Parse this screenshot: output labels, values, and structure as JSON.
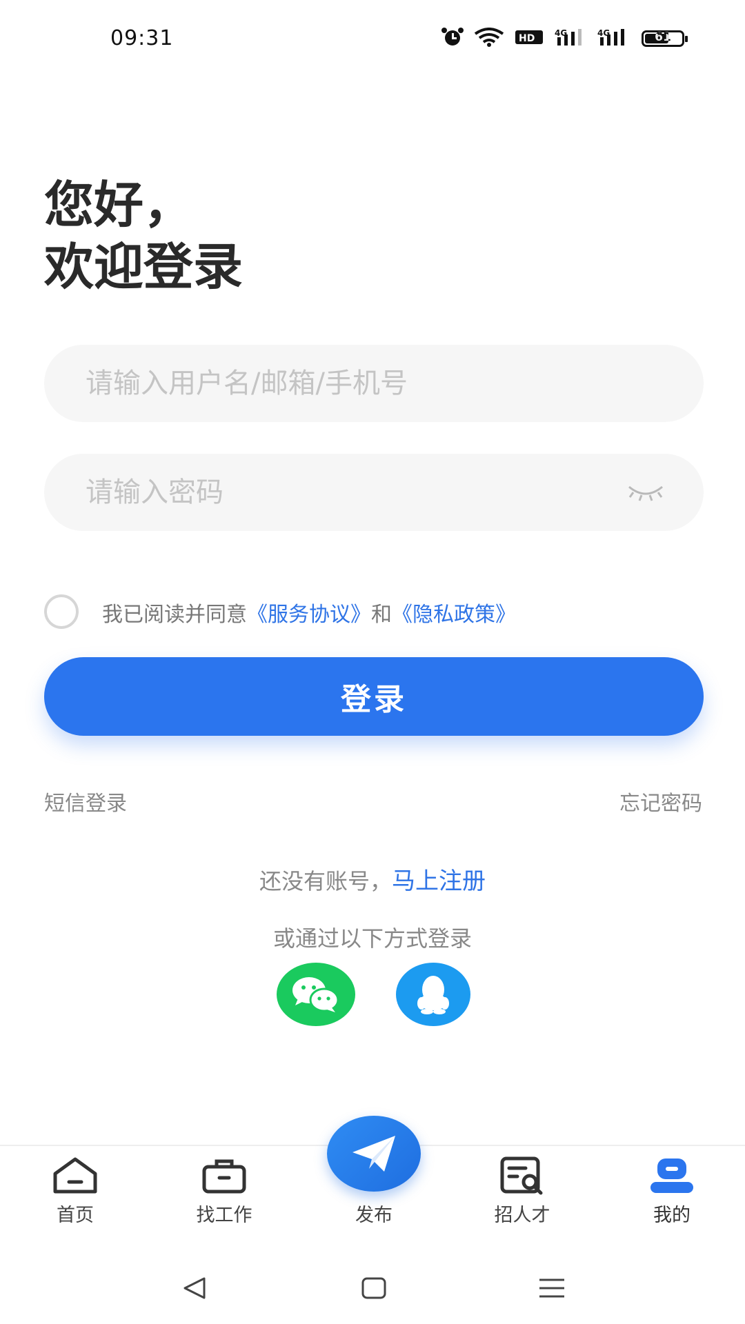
{
  "status_bar": {
    "time": "09:31",
    "icons": [
      "alarm-icon",
      "wifi-icon",
      "hd-icon",
      "signal-4g-icon",
      "signal-4g-icon"
    ],
    "battery": "61"
  },
  "greeting": {
    "line1": "您好，",
    "line2": "欢迎登录"
  },
  "form": {
    "username_placeholder": "请输入用户名/邮箱/手机号",
    "username_value": "",
    "password_placeholder": "请输入密码",
    "password_value": ""
  },
  "agreement": {
    "prefix": "我已阅读并同意",
    "service_link": "《服务协议》",
    "and": "和",
    "privacy_link": "《隐私政策》",
    "checked": false
  },
  "login_button": "登录",
  "links": {
    "sms_login": "短信登录",
    "forgot_password": "忘记密码"
  },
  "register": {
    "prompt": "还没有账号，",
    "link": "马上注册"
  },
  "other_login": {
    "title": "或通过以下方式登录",
    "providers": [
      "wechat-icon",
      "qq-icon"
    ]
  },
  "bottom_nav": {
    "items": [
      {
        "label": "首页",
        "icon": "home-icon"
      },
      {
        "label": "找工作",
        "icon": "briefcase-icon"
      },
      {
        "label": "发布",
        "icon": "paper-plane-icon"
      },
      {
        "label": "招人才",
        "icon": "resume-search-icon"
      },
      {
        "label": "我的",
        "icon": "profile-icon",
        "active": true
      }
    ]
  },
  "colors": {
    "accent": "#2b75ee",
    "link": "#2f74e6",
    "wechat": "#1aca5e",
    "qq": "#1c9bf0"
  }
}
